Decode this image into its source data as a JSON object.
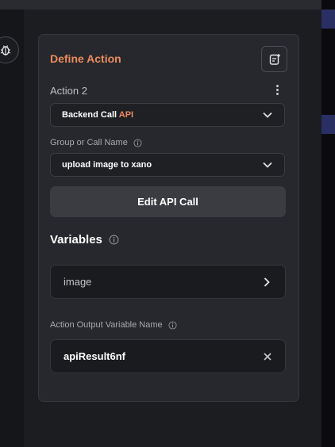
{
  "card": {
    "title": "Define Action",
    "action_label": "Action 2",
    "call_type": {
      "prefix": "Backend Call",
      "accent": "API"
    },
    "group_label": "Group or Call Name",
    "group_value": "upload image to xano",
    "edit_button": "Edit API Call",
    "variables_heading": "Variables",
    "variable_item": "image",
    "output_label": "Action Output Variable Name",
    "output_value": "apiResult6nf"
  },
  "colors": {
    "accent": "#ec8b5e",
    "card_bg": "#26282d",
    "page_bg": "#1a1b1f"
  },
  "icons": [
    "bug-icon",
    "add-note-icon",
    "kebab-menu-icon",
    "chevron-down-icon",
    "info-icon",
    "chevron-right-icon",
    "close-icon"
  ]
}
